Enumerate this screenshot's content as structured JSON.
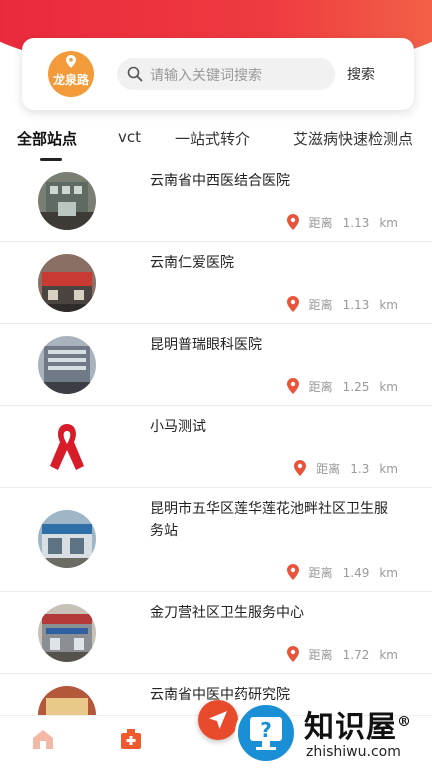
{
  "header": {
    "location_label": "龙泉路",
    "search_placeholder": "请输入关键词搜索",
    "search_button": "搜索",
    "accent_color": "#e8283c"
  },
  "tabs": [
    {
      "label": "全部站点",
      "active": true
    },
    {
      "label": "vct",
      "active": false
    },
    {
      "label": "一站式转介",
      "active": false
    },
    {
      "label": "艾滋病快速检测点",
      "active": false
    }
  ],
  "distance_label": "距离",
  "distance_unit": "km",
  "items": [
    {
      "name": "云南省中西医结合医院",
      "distance": "1.13",
      "avatar": "building-photo"
    },
    {
      "name": "云南仁爱医院",
      "distance": "1.13",
      "avatar": "building-photo"
    },
    {
      "name": "昆明普瑞眼科医院",
      "distance": "1.25",
      "avatar": "building-photo"
    },
    {
      "name": "小马测试",
      "distance": "1.3",
      "avatar": "red-ribbon-icon"
    },
    {
      "name": "昆明市五华区莲华莲花池畔社区卫生服务站",
      "distance": "1.49",
      "avatar": "building-photo"
    },
    {
      "name": "金刀营社区卫生服务中心",
      "distance": "1.72",
      "avatar": "building-photo"
    },
    {
      "name": "云南省中医中药研究院",
      "distance": "",
      "avatar": "building-photo"
    }
  ],
  "bottom_nav": [
    {
      "icon": "home-icon"
    },
    {
      "icon": "hospital-icon"
    },
    {
      "icon": "navigate-icon"
    }
  ],
  "watermark": {
    "title": "知识屋",
    "reg": "®",
    "subtitle": "zhishiwu.com"
  }
}
